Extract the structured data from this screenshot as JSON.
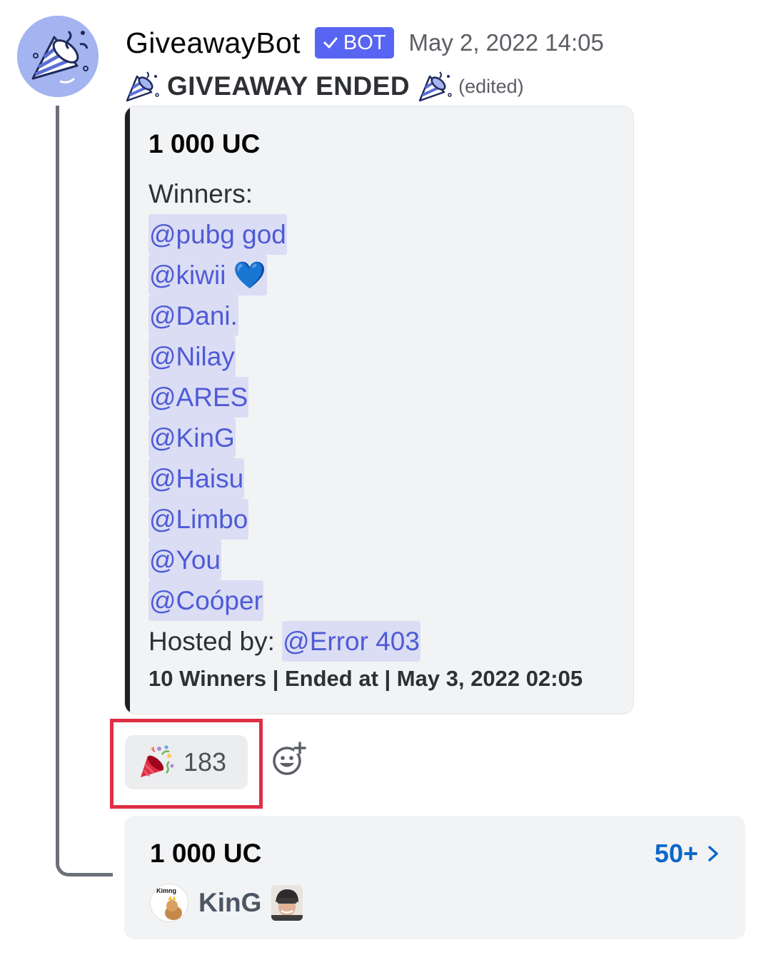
{
  "message": {
    "author": "GiveawayBot",
    "bot_tag": "BOT",
    "timestamp": "May 2, 2022 14:05",
    "title": "GIVEAWAY ENDED",
    "edited": "(edited)"
  },
  "embed": {
    "title": "1 000 UC",
    "winners_label": "Winners:",
    "winners": [
      "@pubg god",
      "@kiwii 💙",
      "@Dani.",
      "@Nilay",
      "@ARES",
      "@KinG",
      "@Haisu",
      "@Limbo",
      "@You",
      "@Coóper"
    ],
    "hosted_label": "Hosted by:",
    "host": "@Error 403",
    "footer": "10 Winners | Ended at | May 3, 2022 02:05"
  },
  "reaction": {
    "icon": "party-popper-icon",
    "count": "183"
  },
  "add_reaction": {
    "icon": "add-reaction-icon"
  },
  "thread": {
    "name": "1 000 UC",
    "count": "50+",
    "last_author_avatar_text": "Kimng",
    "last_author": "KinG"
  },
  "colors": {
    "blurple": "#5865f2",
    "mention_text": "#4e5bd6",
    "highlight_border": "#de2f45",
    "link_blue": "#0a68c9"
  }
}
